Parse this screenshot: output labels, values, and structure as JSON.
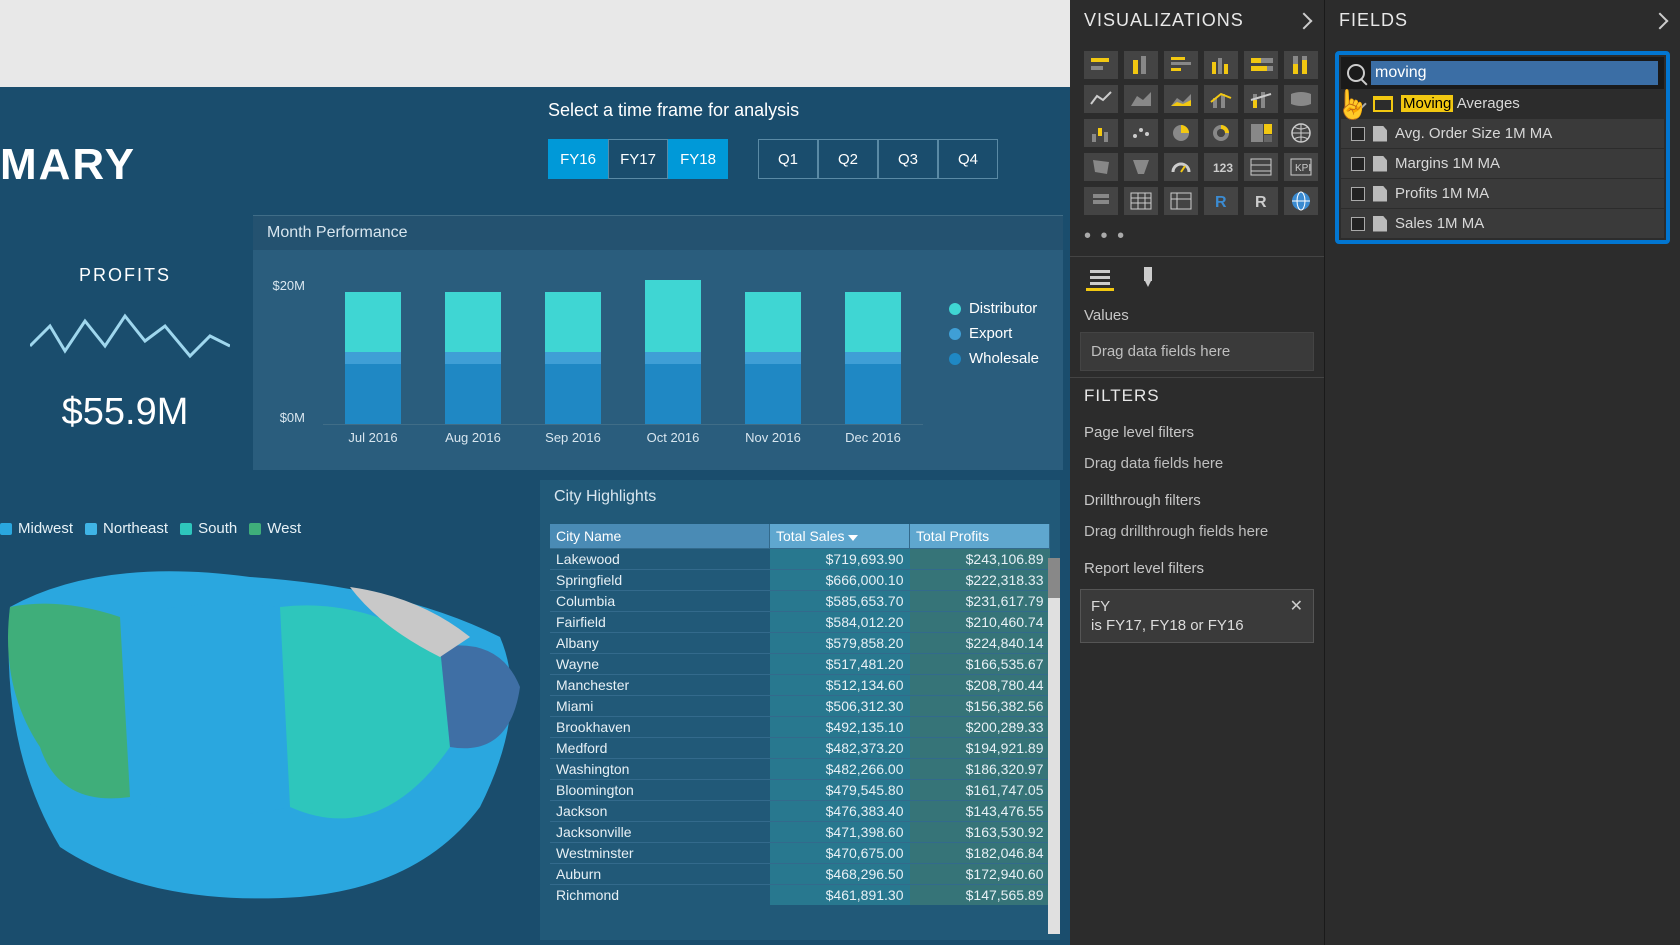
{
  "report": {
    "title_fragment": "MARY",
    "slicer_label": "Select a time frame for analysis",
    "fy_buttons": [
      "FY16",
      "FY17",
      "FY18"
    ],
    "fy_selected": [
      "FY16",
      "FY18"
    ],
    "q_buttons": [
      "Q1",
      "Q2",
      "Q3",
      "Q4"
    ],
    "profits": {
      "label": "PROFITS",
      "value": "$55.9M"
    },
    "month_perf_title": "Month Performance",
    "city_title": "City Highlights",
    "map_regions": [
      {
        "name": "Midwest",
        "color": "#2aa7df"
      },
      {
        "name": "Northeast",
        "color": "#3fb4e6"
      },
      {
        "name": "South",
        "color": "#2ec6bc"
      },
      {
        "name": "West",
        "color": "#3fae7a"
      }
    ]
  },
  "chart_data": {
    "type": "bar",
    "title": "Month Performance",
    "y_ticks": [
      "$20M",
      "$0M"
    ],
    "ylim": [
      0,
      25
    ],
    "categories": [
      "Jul 2016",
      "Aug 2016",
      "Sep 2016",
      "Oct 2016",
      "Nov 2016",
      "Dec 2016"
    ],
    "series": [
      {
        "name": "Distributor",
        "color": "#3fd6d3",
        "values": [
          10,
          10,
          10,
          12,
          10,
          10
        ]
      },
      {
        "name": "Export",
        "color": "#3f9fd6",
        "values": [
          2,
          2,
          2,
          2,
          2,
          2
        ]
      },
      {
        "name": "Wholesale",
        "color": "#1f88c4",
        "values": [
          10,
          10,
          10,
          10,
          10,
          10
        ]
      }
    ]
  },
  "city_table": {
    "columns": [
      "City Name",
      "Total Sales",
      "Total Profits"
    ],
    "sort_col": 1,
    "rows": [
      [
        "Lakewood",
        "$719,693.90",
        "$243,106.89"
      ],
      [
        "Springfield",
        "$666,000.10",
        "$222,318.33"
      ],
      [
        "Columbia",
        "$585,653.70",
        "$231,617.79"
      ],
      [
        "Fairfield",
        "$584,012.20",
        "$210,460.74"
      ],
      [
        "Albany",
        "$579,858.20",
        "$224,840.14"
      ],
      [
        "Wayne",
        "$517,481.20",
        "$166,535.67"
      ],
      [
        "Manchester",
        "$512,134.60",
        "$208,780.44"
      ],
      [
        "Miami",
        "$506,312.30",
        "$156,382.56"
      ],
      [
        "Brookhaven",
        "$492,135.10",
        "$200,289.33"
      ],
      [
        "Medford",
        "$482,373.20",
        "$194,921.89"
      ],
      [
        "Washington",
        "$482,266.00",
        "$186,320.97"
      ],
      [
        "Bloomington",
        "$479,545.80",
        "$161,747.05"
      ],
      [
        "Jackson",
        "$476,383.40",
        "$143,476.55"
      ],
      [
        "Jacksonville",
        "$471,398.60",
        "$163,530.92"
      ],
      [
        "Westminster",
        "$470,675.00",
        "$182,046.84"
      ],
      [
        "Auburn",
        "$468,296.50",
        "$172,940.60"
      ],
      [
        "Richmond",
        "$461,891.30",
        "$147,565.89"
      ]
    ]
  },
  "viz_pane": {
    "title": "VISUALIZATIONS",
    "values_label": "Values",
    "values_placeholder": "Drag data fields here",
    "filters_title": "FILTERS",
    "page_filters": "Page level filters",
    "page_ph": "Drag data fields here",
    "drill_label": "Drillthrough filters",
    "drill_ph": "Drag drillthrough fields here",
    "report_filters": "Report level filters",
    "fy_filter_name": "FY",
    "fy_filter_desc": "is FY17, FY18 or FY16",
    "gallery": [
      "stacked-bar-h",
      "stacked-bar-v",
      "clustered-bar-h",
      "clustered-bar-v",
      "100pct-bar-h",
      "100pct-bar-v",
      "line",
      "area",
      "stacked-area",
      "line-column",
      "line-column-stacked",
      "ribbon",
      "waterfall",
      "scatter",
      "pie",
      "donut",
      "treemap",
      "map",
      "filled-map",
      "funnel",
      "gauge",
      "card",
      "multi-card",
      "kpi",
      "slicer",
      "table",
      "matrix",
      "r-visual",
      "r-script",
      "globe"
    ]
  },
  "fields_pane": {
    "title": "FIELDS",
    "search_value": "moving",
    "table_name_pre": "Moving",
    "table_name_post": " Averages",
    "fields": [
      "Avg. Order Size 1M MA",
      "Margins 1M MA",
      "Profits 1M MA",
      "Sales 1M MA"
    ]
  }
}
